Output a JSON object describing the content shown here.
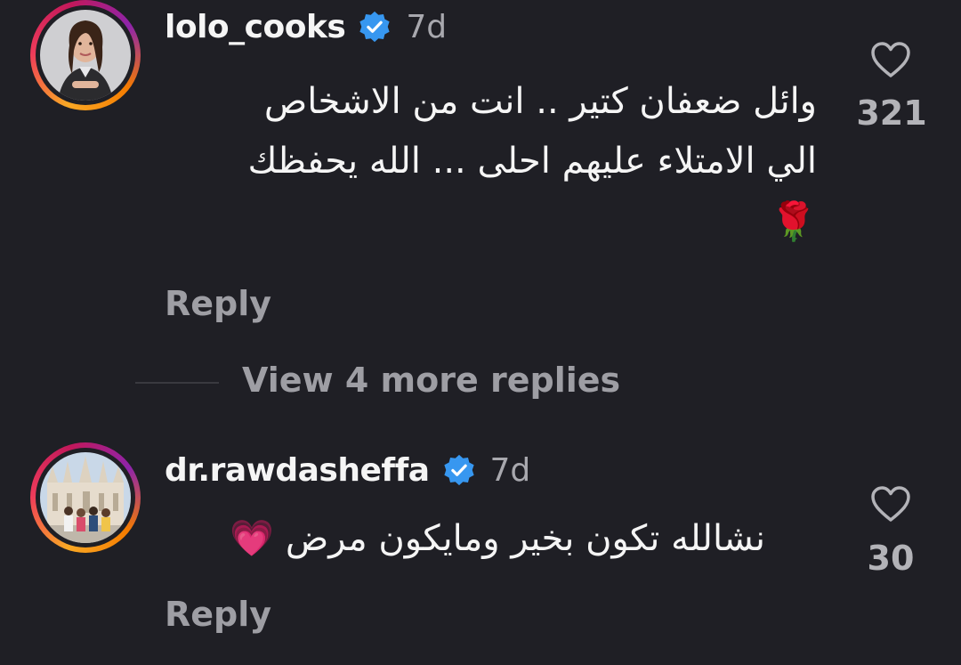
{
  "comments": [
    {
      "username": "lolo_cooks",
      "verified": true,
      "time": "7d",
      "text_lines": [
        "وائل ضعفان كتير .. انت من الاشخاص",
        "الي الامتلاء عليهم احلى ... الله يحفظك",
        "🌹"
      ],
      "likes": "321",
      "reply_label": "Reply",
      "avatar_icon": "chef-profile-photo"
    },
    {
      "username": "dr.rawdasheffa",
      "verified": true,
      "time": "7d",
      "text": "نشالله تكون بخير ومايكون مرض 💗",
      "likes": "30",
      "reply_label": "Reply",
      "avatar_icon": "cathedral-group-photo"
    }
  ],
  "view_more_replies": "View 4 more replies",
  "colors": {
    "background": "#1f1f25",
    "text_primary": "#f5f5f5",
    "text_secondary": "#a8a8ae",
    "verified_blue": "#3797f0"
  }
}
